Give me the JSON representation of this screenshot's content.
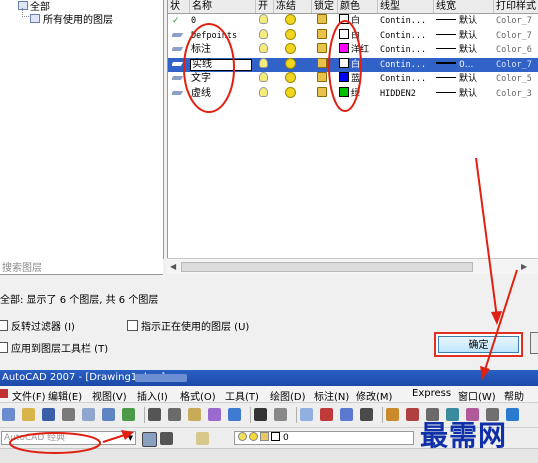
{
  "tree": {
    "root_label": "全部",
    "child_label": "所有使用的图层",
    "search_placeholder": "搜索图层"
  },
  "grid": {
    "headers": [
      "状",
      "名称",
      "开",
      "冻结",
      "锁定",
      "颜色",
      "线型",
      "线宽",
      "打印样式"
    ],
    "rows": [
      {
        "status": "✓",
        "name": "0",
        "color": "白",
        "color_hex": "#ffffff",
        "linetype": "Contin...",
        "lineweight": "默认",
        "plotstyle": "Color_7",
        "selected": false
      },
      {
        "status": "",
        "name": "Defpoints",
        "color": "白",
        "color_hex": "#ffffff",
        "linetype": "Contin...",
        "lineweight": "默认",
        "plotstyle": "Color_7",
        "selected": false
      },
      {
        "status": "",
        "name": "标注",
        "color": "洋红",
        "color_hex": "#ff00ff",
        "linetype": "Contin...",
        "lineweight": "默认",
        "plotstyle": "Color_6",
        "selected": false
      },
      {
        "status": "",
        "name": "实线",
        "color": "白",
        "color_hex": "#ffffff",
        "linetype": "Contin...",
        "lineweight": "0...",
        "plotstyle": "Color_7",
        "selected": true
      },
      {
        "status": "",
        "name": "文字",
        "color": "蓝",
        "color_hex": "#0000ff",
        "linetype": "Contin...",
        "lineweight": "默认",
        "plotstyle": "Color_5",
        "selected": false
      },
      {
        "status": "",
        "name": "虚线",
        "color": "绿",
        "color_hex": "#00c000",
        "linetype": "HIDDEN2",
        "lineweight": "默认",
        "plotstyle": "Color_3",
        "selected": false
      }
    ]
  },
  "summary": "全部: 显示了 6 个图层, 共 6 个图层",
  "options": {
    "invert_filter": "反转过滤器 (I)",
    "apply_to_toolbar": "应用到图层工具栏 (T)",
    "indicate_in_use": "指示正在使用的图层 (U)"
  },
  "buttons": {
    "ok": "确定"
  },
  "app": {
    "title": "AutoCAD 2007 - [Drawing1.dwg]",
    "menus": [
      "文件(F)",
      "编辑(E)",
      "视图(V)",
      "插入(I)",
      "格式(O)",
      "工具(T)",
      "绘图(D)",
      "标注(N)",
      "修改(M)",
      "Express",
      "窗口(W)",
      "帮助"
    ],
    "workspace": "AutoCAD 经典",
    "layer_combo_value": "0"
  },
  "watermark": "最需网",
  "colors": {
    "selection": "#3162c7",
    "annotation": "#e02010",
    "title_bar": "#1f52b5"
  }
}
